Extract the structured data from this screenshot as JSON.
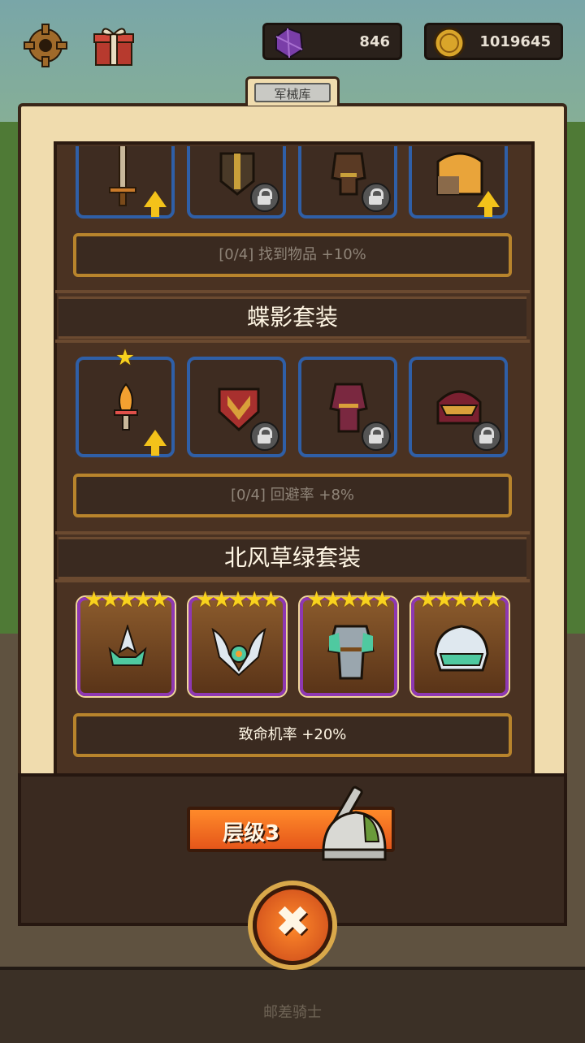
{
  "top_bar": {
    "settings_icon": "gear-icon",
    "gift_icon": "gift-box-icon",
    "gems": {
      "icon": "purple-gem-icon",
      "value": "846"
    },
    "coins": {
      "icon": "gold-coin-icon",
      "value": "1019645"
    }
  },
  "panel": {
    "title": "军械库"
  },
  "sets": [
    {
      "name": "",
      "items": [
        {
          "icon": "sword-icon",
          "locked": false,
          "upgrade": true
        },
        {
          "icon": "shield-icon",
          "locked": true,
          "upgrade": false
        },
        {
          "icon": "armor-icon",
          "locked": true,
          "upgrade": false
        },
        {
          "icon": "helmet-icon",
          "locked": false,
          "upgrade": true
        }
      ],
      "bonus": "[0/4] 找到物品 +10%"
    },
    {
      "name": "蝶影套装",
      "items": [
        {
          "icon": "dagger-icon",
          "locked": false,
          "upgrade": true,
          "stars": 1
        },
        {
          "icon": "shield-icon",
          "locked": true,
          "upgrade": false
        },
        {
          "icon": "armor-icon",
          "locked": true,
          "upgrade": false
        },
        {
          "icon": "helmet-icon",
          "locked": true,
          "upgrade": false
        }
      ],
      "bonus": "[0/4] 回避率 +8%"
    },
    {
      "name": "北风草绿套装",
      "items": [
        {
          "icon": "trident-weapon-icon",
          "stars": 5
        },
        {
          "icon": "winged-shield-icon",
          "stars": 5
        },
        {
          "icon": "armor-icon",
          "stars": 5
        },
        {
          "icon": "helmet-icon",
          "stars": 5
        }
      ],
      "bonus": "致命机率 +20%"
    }
  ],
  "bottom": {
    "level_label": "层级3",
    "level_icon": "knight-helmet-sword-icon",
    "close_icon": "close-icon",
    "close_symbol": "✖"
  },
  "footer": "邮差骑士",
  "colors": {
    "slot_normal_border": "#2f5fa7",
    "slot_legend_border": "#8e38b2",
    "bonus_border": "#b8842c",
    "accent_orange": "#e5561a",
    "star": "#f8d21e"
  }
}
